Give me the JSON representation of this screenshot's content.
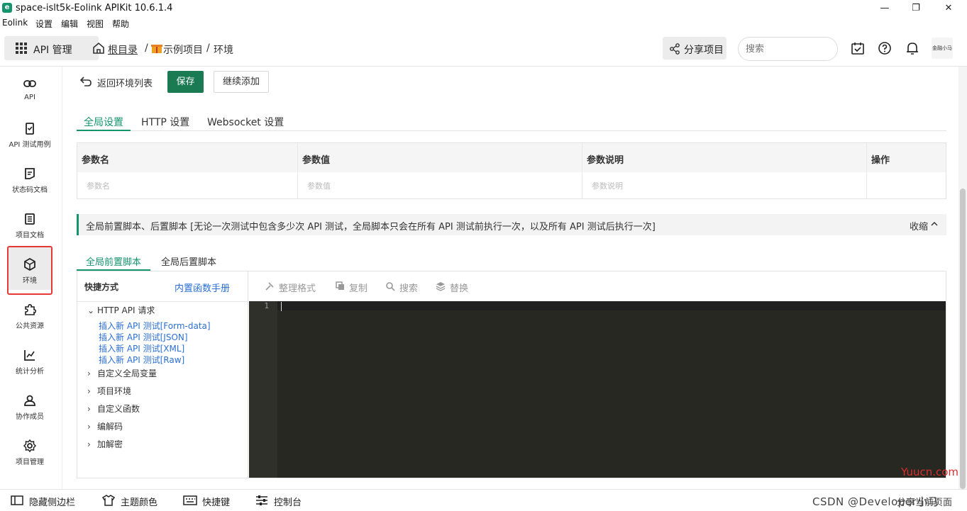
{
  "window": {
    "title": "space-islt5k-Eolink APIKit 10.6.1.4",
    "logo_letter": "e",
    "minimize": "—",
    "maximize": "❐",
    "close": "✕"
  },
  "menu": [
    "Eolink",
    "设置",
    "编辑",
    "视图",
    "帮助"
  ],
  "header": {
    "api_manage": "API 管理",
    "breadcrumb": [
      "根目录",
      "示例项目",
      "环境"
    ],
    "separator": "/",
    "share_label": "分享项目",
    "search_placeholder": "搜索",
    "avatar_text": "金融小马"
  },
  "sidebar": {
    "items": [
      {
        "label": "API",
        "icon": "link-icon"
      },
      {
        "label": "API 测试用例",
        "icon": "clipboard-check-icon"
      },
      {
        "label": "状态码文档",
        "icon": "code-doc-icon"
      },
      {
        "label": "项目文档",
        "icon": "document-icon"
      },
      {
        "label": "环境",
        "icon": "environment-icon"
      },
      {
        "label": "公共资源",
        "icon": "puzzle-icon"
      },
      {
        "label": "统计分析",
        "icon": "chart-icon"
      },
      {
        "label": "协作成员",
        "icon": "user-icon"
      },
      {
        "label": "项目管理",
        "icon": "gear-icon"
      }
    ],
    "active": "环境"
  },
  "actions": {
    "back": "返回环境列表",
    "save": "保存",
    "continue_add": "继续添加"
  },
  "tabs": [
    "全局设置",
    "HTTP 设置",
    "Websocket 设置"
  ],
  "params_table": {
    "headers": [
      "参数名",
      "参数值",
      "参数说明",
      "操作"
    ],
    "placeholders": [
      "参数名",
      "参数值",
      "参数说明"
    ]
  },
  "notice": {
    "text": "全局前置脚本、后置脚本 [无论一次测试中包含多少次 API 测试，全局脚本只会在所有 API 测试前执行一次，以及所有 API 测试后执行一次]",
    "collapse": "收缩"
  },
  "script_tabs": [
    "全局前置脚本",
    "全局后置脚本"
  ],
  "shortcuts": {
    "title": "快捷方式",
    "manual": "内置函数手册",
    "groups": [
      {
        "label": "HTTP API 请求",
        "expanded": true,
        "children": [
          "插入新 API 测试[Form-data]",
          "插入新 API 测试[JSON]",
          "插入新 API 测试[XML]",
          "插入新 API 测试[Raw]"
        ]
      },
      {
        "label": "自定义全局变量",
        "expanded": false
      },
      {
        "label": "项目环境",
        "expanded": false
      },
      {
        "label": "自定义函数",
        "expanded": false
      },
      {
        "label": "编解码",
        "expanded": false
      },
      {
        "label": "加解密",
        "expanded": false
      }
    ]
  },
  "editor_toolbar": [
    "整理格式",
    "复制",
    "搜索",
    "替换"
  ],
  "editor": {
    "line_number": "1"
  },
  "statusbar": [
    "隐藏侧边栏",
    "主题颜色",
    "快捷键",
    "控制台",
    "分享当前页面"
  ],
  "watermark": {
    "csdn": "CSDN @Developer小马",
    "site": "Yuucn.com"
  }
}
